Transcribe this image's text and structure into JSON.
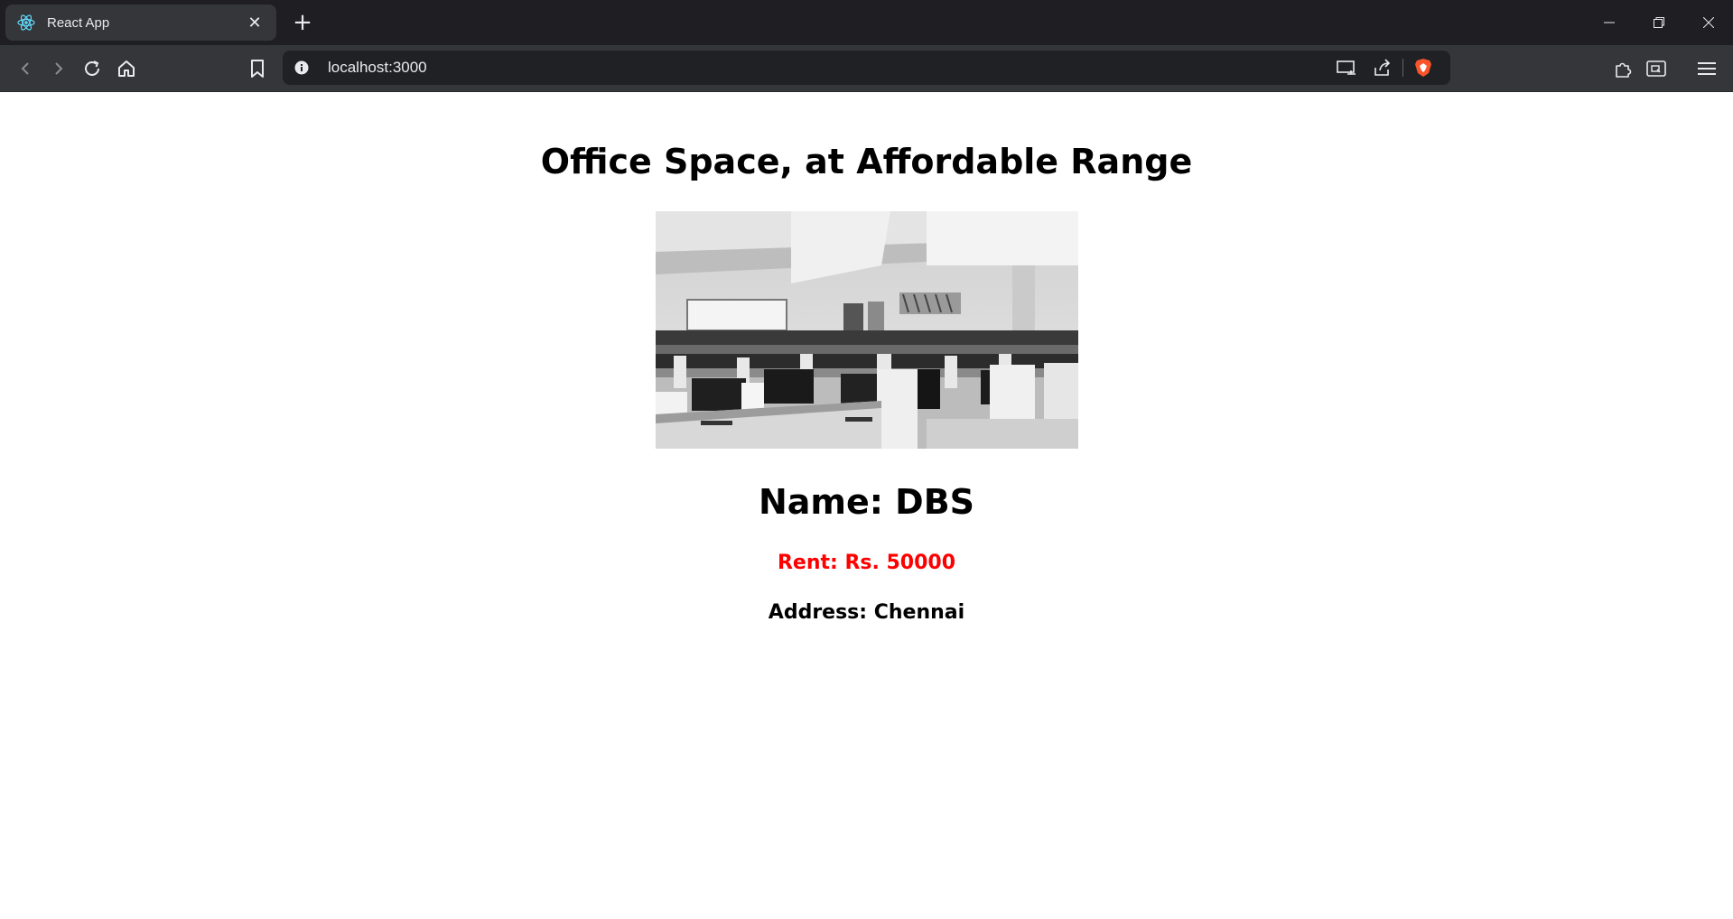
{
  "browser": {
    "tab_title": "React App",
    "tab_favicon": "react-icon",
    "url": "localhost:3000"
  },
  "page": {
    "heading": "Office Space, at Affordable Range",
    "image_subject": "office-room-with-computer-desks",
    "name_line": "Name: DBS",
    "rent_line": "Rent: Rs. 50000",
    "address_line": "Address: Chennai",
    "rent_color": "#ff0000"
  }
}
